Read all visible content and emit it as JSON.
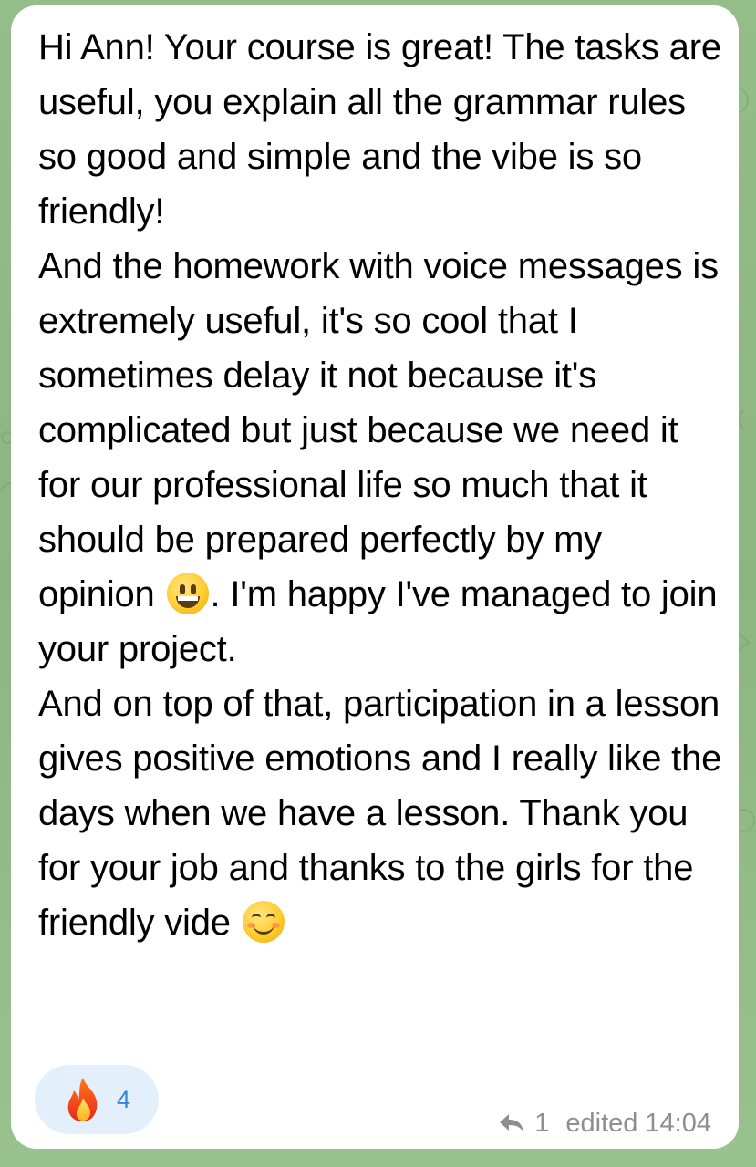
{
  "message": {
    "paragraph_1": "Hi Ann! Your course is great! The tasks are useful, you explain all the grammar rules so good and simple and the vibe is so friendly!",
    "paragraph_2_part_1": "And the homework with voice messages is extremely useful, it's so cool that I sometimes delay it not because it's complicated but just because we need it  for our professional life so much that it should be prepared perfectly by my opinion ",
    "paragraph_2_part_2": ". I'm happy I've managed to join your project.",
    "paragraph_3": "And on top of that, participation in a lesson gives positive emotions and I really like the days when we have a lesson. Thank you for your job and thanks to the girls for the friendly vide ",
    "emoji_1": "grinning-face-icon",
    "emoji_2": "smiling-face-icon"
  },
  "reaction": {
    "icon": "fire-icon",
    "count": "4"
  },
  "meta": {
    "reply_count": "1",
    "edited_label": "edited",
    "time": "14:04"
  },
  "colors": {
    "background": "#8fb885",
    "bubble": "#ffffff",
    "reaction_chip": "#e3f0fb",
    "reaction_count": "#2f86d6",
    "meta_text": "#8e8e93"
  }
}
